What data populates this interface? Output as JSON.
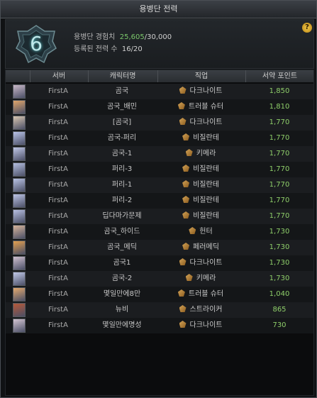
{
  "window": {
    "title": "용병단 전력"
  },
  "header": {
    "level": "6",
    "exp_label": "용병단 경험치",
    "exp_current": "25,605",
    "exp_max": "/30,000",
    "count_label": "등록된 전력 수",
    "count_value": "16/20",
    "help_icon": "?"
  },
  "columns": [
    "서버",
    "캐릭터명",
    "직업",
    "서약 포인트"
  ],
  "rows": [
    {
      "server": "FirstA",
      "name": "곰국",
      "job": "다크나이트",
      "points": "1,850",
      "avatar": "#c9b8c8"
    },
    {
      "server": "FirstA",
      "name": "곰국_배민",
      "job": "트러블 슈터",
      "points": "1,810",
      "avatar": "#e0a56a"
    },
    {
      "server": "FirstA",
      "name": "[곰국]",
      "job": "다크나이트",
      "points": "1,770",
      "avatar": "#d8c6b0"
    },
    {
      "server": "FirstA",
      "name": "곰국-퍼리",
      "job": "비질란테",
      "points": "1,770",
      "avatar": "#b9c3e8"
    },
    {
      "server": "FirstA",
      "name": "곰국-1",
      "job": "키메라",
      "points": "1,770",
      "avatar": "#bfc6e6"
    },
    {
      "server": "FirstA",
      "name": "퍼리-3",
      "job": "비질란테",
      "points": "1,770",
      "avatar": "#b4bedf"
    },
    {
      "server": "FirstA",
      "name": "퍼리-1",
      "job": "비질란테",
      "points": "1,770",
      "avatar": "#b8c2e3"
    },
    {
      "server": "FirstA",
      "name": "퍼리-2",
      "job": "비질란테",
      "points": "1,770",
      "avatar": "#bcc4e6"
    },
    {
      "server": "FirstA",
      "name": "딥다마가문제",
      "job": "비질란테",
      "points": "1,770",
      "avatar": "#b7bfe1"
    },
    {
      "server": "FirstA",
      "name": "곰국_하이드",
      "job": "헌터",
      "points": "1,730",
      "avatar": "#d7b59b"
    },
    {
      "server": "FirstA",
      "name": "곰국_메딕",
      "job": "페러메딕",
      "points": "1,730",
      "avatar": "#e4a04e"
    },
    {
      "server": "FirstA",
      "name": "곰국1",
      "job": "다크나이트",
      "points": "1,730",
      "avatar": "#cfc0cf"
    },
    {
      "server": "FirstA",
      "name": "곰국-2",
      "job": "키메라",
      "points": "1,730",
      "avatar": "#c0c8e8"
    },
    {
      "server": "FirstA",
      "name": "몇일만에8만",
      "job": "트러블 슈터",
      "points": "1,040",
      "avatar": "#e3a96e"
    },
    {
      "server": "FirstA",
      "name": "뉴비",
      "job": "스트라이커",
      "points": "865",
      "avatar": "#b75a3a"
    },
    {
      "server": "FirstA",
      "name": "몇일만에명성",
      "job": "다크나이트",
      "points": "730",
      "avatar": "#d4c5d2"
    }
  ]
}
